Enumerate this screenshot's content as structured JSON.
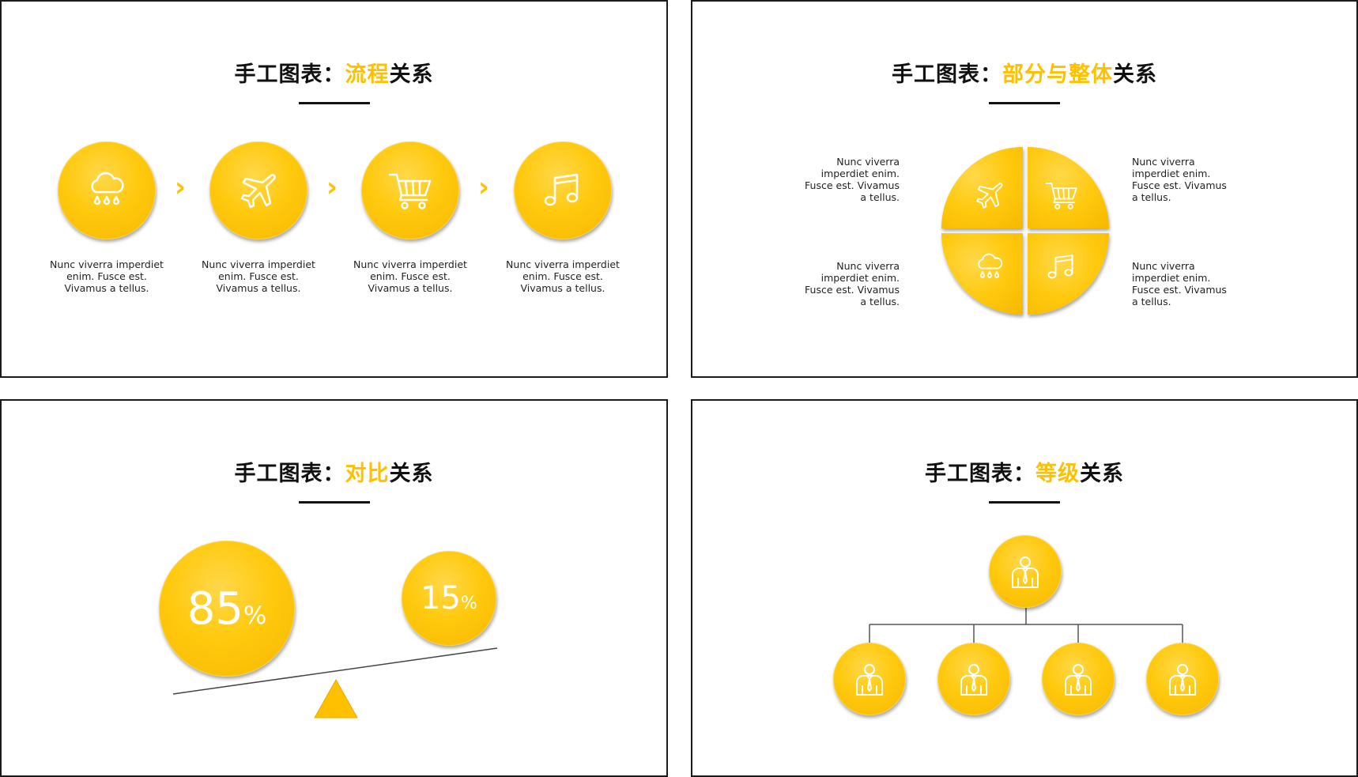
{
  "slides": [
    {
      "title_prefix": "手工图表：",
      "title_highlight": "流程",
      "title_suffix": "关系",
      "steps": [
        {
          "icon": "cloud-rain-icon",
          "text": "Nunc viverra imperdiet enim. Fusce est. Vivamus a tellus."
        },
        {
          "icon": "airplane-icon",
          "text": "Nunc viverra imperdiet enim. Fusce est. Vivamus a tellus."
        },
        {
          "icon": "shopping-cart-icon",
          "text": "Nunc viverra imperdiet enim. Fusce est. Vivamus a tellus."
        },
        {
          "icon": "music-note-icon",
          "text": "Nunc viverra imperdiet enim. Fusce est. Vivamus a tellus."
        }
      ],
      "arrow": "›"
    },
    {
      "title_prefix": "手工图表：",
      "title_highlight": "部分与整体",
      "title_suffix": "关系",
      "quadrants": [
        "airplane-icon",
        "shopping-cart-icon",
        "cloud-rain-icon",
        "music-note-icon"
      ],
      "captions": {
        "top_left": "Nunc viverra imperdiet enim. Fusce est. Vivamus a tellus.",
        "top_right": "Nunc viverra imperdiet enim. Fusce est. Vivamus a tellus.",
        "bottom_left": "Nunc viverra imperdiet enim. Fusce est. Vivamus a tellus.",
        "bottom_right": "Nunc viverra imperdiet enim. Fusce est. Vivamus a tellus."
      }
    },
    {
      "title_prefix": "手工图表：",
      "title_highlight": "对比",
      "title_suffix": "关系",
      "big_value": "85",
      "small_value": "15",
      "percent_sign": "%"
    },
    {
      "title_prefix": "手工图表：",
      "title_highlight": "等级",
      "title_suffix": "关系",
      "top_node_icon": "person-icon",
      "child_count_icon": "person-icon"
    }
  ],
  "colors": {
    "accent": "#ffc000",
    "text": "#111111",
    "border": "#1a1a1a"
  }
}
